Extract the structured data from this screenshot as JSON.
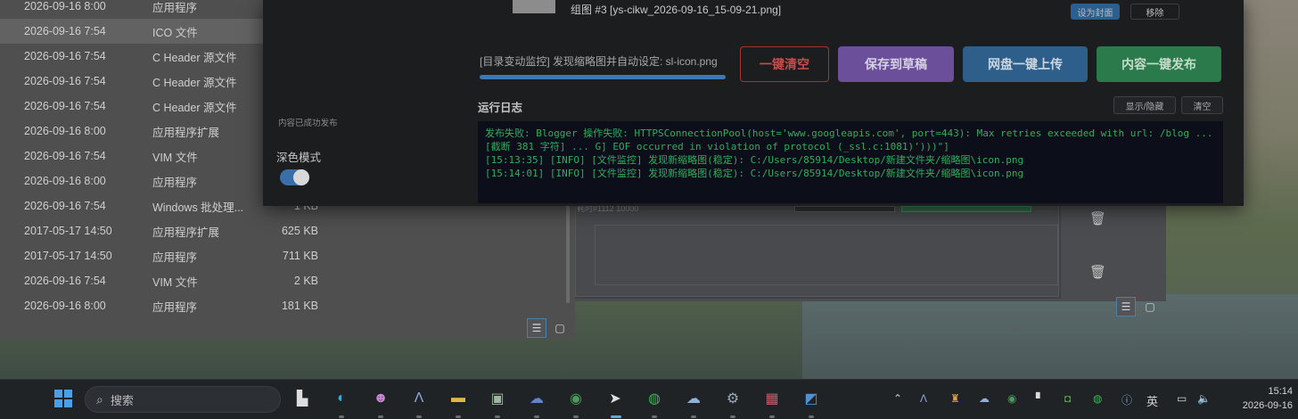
{
  "explorer": {
    "rows": [
      {
        "date": "2026-09-16 8:00",
        "type": "应用程序",
        "size": ""
      },
      {
        "date": "2026-09-16 7:54",
        "type": "ICO 文件",
        "size": ""
      },
      {
        "date": "2026-09-16 7:54",
        "type": "C Header 源文件",
        "size": ""
      },
      {
        "date": "2026-09-16 7:54",
        "type": "C Header 源文件",
        "size": ""
      },
      {
        "date": "2026-09-16 7:54",
        "type": "C Header 源文件",
        "size": ""
      },
      {
        "date": "2026-09-16 8:00",
        "type": "应用程序扩展",
        "size": ""
      },
      {
        "date": "2026-09-16 7:54",
        "type": "VIM 文件",
        "size": ""
      },
      {
        "date": "2026-09-16 8:00",
        "type": "应用程序",
        "size": ""
      },
      {
        "date": "2026-09-16 7:54",
        "type": "Windows 批处理...",
        "size": "1 KB"
      },
      {
        "date": "2017-05-17 14:50",
        "type": "应用程序扩展",
        "size": "625 KB"
      },
      {
        "date": "2017-05-17 14:50",
        "type": "应用程序",
        "size": "711 KB"
      },
      {
        "date": "2026-09-16 7:54",
        "type": "VIM 文件",
        "size": "2 KB"
      },
      {
        "date": "2026-09-16 8:00",
        "type": "应用程序",
        "size": "181 KB"
      }
    ],
    "selected_index": 1,
    "details_view_icon": "details-view-icon",
    "tiles_view_icon": "tiles-view-icon"
  },
  "app": {
    "sidebar_status": "内容已成功发布",
    "dark_mode_label": "深色模式",
    "dark_mode_on": true,
    "queue_item_label": "组图 #3 [ys-cikw_2026-09-16_15-09-21.png]",
    "queue_btn_primary": "设为封面",
    "queue_btn_remove": "移除",
    "status_text": "[目录变动监控] 发现缩略图并自动设定: sl-icon.png",
    "progress_fraction": 1.0,
    "buttons": {
      "clear": "一键清空",
      "draft": "保存到草稿",
      "upload": "网盘一键上传",
      "publish": "内容一键发布"
    },
    "log_title": "运行日志",
    "log_toggle": "显示/隐藏",
    "log_clear": "清空",
    "log_lines": [
      "发布失败: Blogger 操作失败: HTTPSConnectionPool(host='www.googleapis.com', port=443): Max retries exceeded with url: /blog ... [截断 381 字符] ... G] EOF occurred in violation of protocol (_ssl.c:1081)')))\"]",
      "[15:13:35] [INFO] [文件监控] 发现新缩略图(稳定): C:/Users/85914/Desktop/新建文件夹/缩略图\\icon.png",
      "[15:14:01] [INFO] [文件监控] 发现新缩略图(稳定): C:/Users/85914/Desktop/新建文件夹/缩略图\\icon.png"
    ],
    "colors": {
      "log_text": "#2fae5c",
      "clear_border": "#a83232",
      "draft": "#6c4f9a",
      "upload": "#2d5f8a",
      "publish": "#2a7a4c"
    }
  },
  "bg_window": {
    "partial_text": "耗时#1112 10000"
  },
  "taskbar": {
    "search_placeholder": "搜索",
    "tray_language": "英",
    "time": "15:14",
    "date": "2026-09-16",
    "pinned_icons": [
      "windows-start-icon",
      "search-icon",
      "task-view-icon",
      "edge-icon",
      "cat-app-icon",
      "text-app-icon",
      "file-explorer-icon",
      "photos-icon",
      "cloud-app-icon",
      "browser-app-icon",
      "paper-plane-icon",
      "wechat-icon",
      "cloud-sync-icon",
      "settings-icon",
      "winrar-icon",
      "photo-editor-icon"
    ]
  }
}
